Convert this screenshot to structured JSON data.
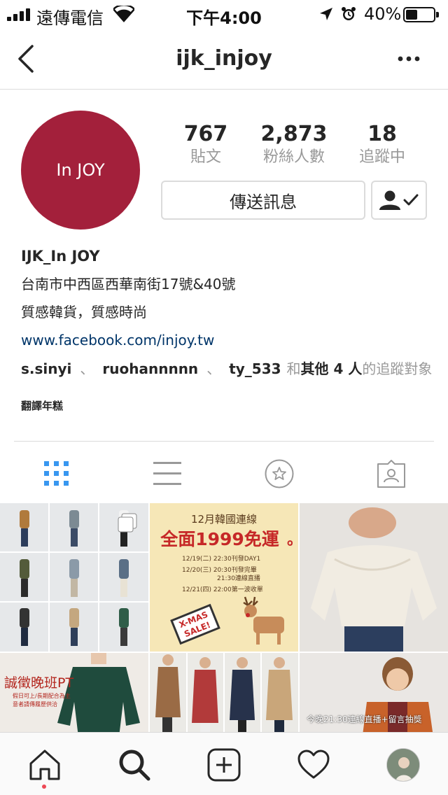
{
  "status_bar": {
    "carrier": "遠傳電信",
    "time": "下午4:00",
    "battery_text": "40%",
    "battery_level": 0.4
  },
  "nav": {
    "title": "ijk_injoy"
  },
  "profile": {
    "avatar_text": "In JOY",
    "brand_color": "#a3203b",
    "stats": [
      {
        "value": "767",
        "label": "貼文"
      },
      {
        "value": "2,873",
        "label": "粉絲人數"
      },
      {
        "value": "18",
        "label": "追蹤中"
      }
    ],
    "message_button": "傳送訊息",
    "name": "IJK_In JOY",
    "bio_lines": [
      "台南市中西區西華南街17號&40號",
      "質感韓貨，質感時尚"
    ],
    "link": "www.facebook.com/injoy.tw",
    "followed_by": {
      "users": [
        "s.sinyi",
        "ruohannnnn",
        "ty_533"
      ],
      "sep": "、",
      "prefix": "和",
      "others": "其他 4 人",
      "suffix": "的追蹤對象"
    },
    "translate": "翻譯年糕"
  },
  "tabs": {
    "icons": [
      "grid-icon",
      "list-icon",
      "star-icon",
      "tagged-icon"
    ],
    "active": 0,
    "active_color": "#3897f0"
  },
  "posts": [
    {
      "type": "photo-collage",
      "icon": "multi-photo-icon"
    },
    {
      "type": "poster",
      "heading": "12月韓國連線",
      "headline": "全面1999免運",
      "suffix_mark": "。",
      "schedule": [
        "12/19(二) 22:30刊發DAY1",
        "12/20(三) 20:30刊發完畢",
        "21:30連線直播",
        "12/21(四) 22:00第一波收單"
      ],
      "sign_line1": "X-MAS",
      "sign_line2": "SALE!"
    },
    {
      "type": "photo"
    },
    {
      "type": "photo",
      "headline": "誠徵晚班PT",
      "sub1": "假日可上/長期配合為主",
      "sub2": "意者請傳履歷供洽"
    },
    {
      "type": "photo-strip"
    },
    {
      "type": "photo",
      "caption": "今晚21:30連線直播+留言抽獎"
    }
  ],
  "bottom_bar": {
    "icons": [
      "home-icon",
      "search-icon",
      "new-post-icon",
      "activity-icon",
      "profile-icon"
    ]
  }
}
